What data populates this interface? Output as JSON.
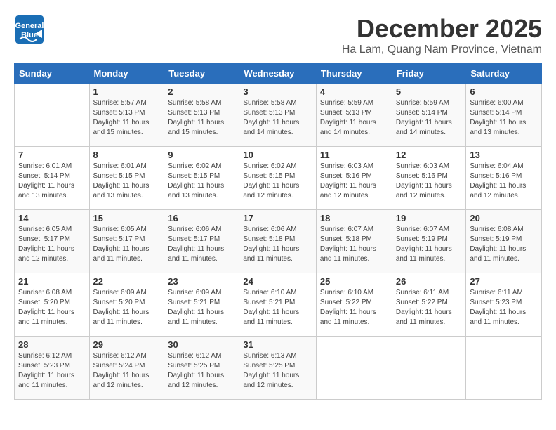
{
  "header": {
    "logo_general": "General",
    "logo_blue": "Blue",
    "month_title": "December 2025",
    "subtitle": "Ha Lam, Quang Nam Province, Vietnam"
  },
  "weekdays": [
    "Sunday",
    "Monday",
    "Tuesday",
    "Wednesday",
    "Thursday",
    "Friday",
    "Saturday"
  ],
  "weeks": [
    [
      {
        "day": "",
        "info": ""
      },
      {
        "day": "1",
        "info": "Sunrise: 5:57 AM\nSunset: 5:13 PM\nDaylight: 11 hours\nand 15 minutes."
      },
      {
        "day": "2",
        "info": "Sunrise: 5:58 AM\nSunset: 5:13 PM\nDaylight: 11 hours\nand 15 minutes."
      },
      {
        "day": "3",
        "info": "Sunrise: 5:58 AM\nSunset: 5:13 PM\nDaylight: 11 hours\nand 14 minutes."
      },
      {
        "day": "4",
        "info": "Sunrise: 5:59 AM\nSunset: 5:13 PM\nDaylight: 11 hours\nand 14 minutes."
      },
      {
        "day": "5",
        "info": "Sunrise: 5:59 AM\nSunset: 5:14 PM\nDaylight: 11 hours\nand 14 minutes."
      },
      {
        "day": "6",
        "info": "Sunrise: 6:00 AM\nSunset: 5:14 PM\nDaylight: 11 hours\nand 13 minutes."
      }
    ],
    [
      {
        "day": "7",
        "info": "Sunrise: 6:01 AM\nSunset: 5:14 PM\nDaylight: 11 hours\nand 13 minutes."
      },
      {
        "day": "8",
        "info": "Sunrise: 6:01 AM\nSunset: 5:15 PM\nDaylight: 11 hours\nand 13 minutes."
      },
      {
        "day": "9",
        "info": "Sunrise: 6:02 AM\nSunset: 5:15 PM\nDaylight: 11 hours\nand 13 minutes."
      },
      {
        "day": "10",
        "info": "Sunrise: 6:02 AM\nSunset: 5:15 PM\nDaylight: 11 hours\nand 12 minutes."
      },
      {
        "day": "11",
        "info": "Sunrise: 6:03 AM\nSunset: 5:16 PM\nDaylight: 11 hours\nand 12 minutes."
      },
      {
        "day": "12",
        "info": "Sunrise: 6:03 AM\nSunset: 5:16 PM\nDaylight: 11 hours\nand 12 minutes."
      },
      {
        "day": "13",
        "info": "Sunrise: 6:04 AM\nSunset: 5:16 PM\nDaylight: 11 hours\nand 12 minutes."
      }
    ],
    [
      {
        "day": "14",
        "info": "Sunrise: 6:05 AM\nSunset: 5:17 PM\nDaylight: 11 hours\nand 12 minutes."
      },
      {
        "day": "15",
        "info": "Sunrise: 6:05 AM\nSunset: 5:17 PM\nDaylight: 11 hours\nand 11 minutes."
      },
      {
        "day": "16",
        "info": "Sunrise: 6:06 AM\nSunset: 5:17 PM\nDaylight: 11 hours\nand 11 minutes."
      },
      {
        "day": "17",
        "info": "Sunrise: 6:06 AM\nSunset: 5:18 PM\nDaylight: 11 hours\nand 11 minutes."
      },
      {
        "day": "18",
        "info": "Sunrise: 6:07 AM\nSunset: 5:18 PM\nDaylight: 11 hours\nand 11 minutes."
      },
      {
        "day": "19",
        "info": "Sunrise: 6:07 AM\nSunset: 5:19 PM\nDaylight: 11 hours\nand 11 minutes."
      },
      {
        "day": "20",
        "info": "Sunrise: 6:08 AM\nSunset: 5:19 PM\nDaylight: 11 hours\nand 11 minutes."
      }
    ],
    [
      {
        "day": "21",
        "info": "Sunrise: 6:08 AM\nSunset: 5:20 PM\nDaylight: 11 hours\nand 11 minutes."
      },
      {
        "day": "22",
        "info": "Sunrise: 6:09 AM\nSunset: 5:20 PM\nDaylight: 11 hours\nand 11 minutes."
      },
      {
        "day": "23",
        "info": "Sunrise: 6:09 AM\nSunset: 5:21 PM\nDaylight: 11 hours\nand 11 minutes."
      },
      {
        "day": "24",
        "info": "Sunrise: 6:10 AM\nSunset: 5:21 PM\nDaylight: 11 hours\nand 11 minutes."
      },
      {
        "day": "25",
        "info": "Sunrise: 6:10 AM\nSunset: 5:22 PM\nDaylight: 11 hours\nand 11 minutes."
      },
      {
        "day": "26",
        "info": "Sunrise: 6:11 AM\nSunset: 5:22 PM\nDaylight: 11 hours\nand 11 minutes."
      },
      {
        "day": "27",
        "info": "Sunrise: 6:11 AM\nSunset: 5:23 PM\nDaylight: 11 hours\nand 11 minutes."
      }
    ],
    [
      {
        "day": "28",
        "info": "Sunrise: 6:12 AM\nSunset: 5:23 PM\nDaylight: 11 hours\nand 11 minutes."
      },
      {
        "day": "29",
        "info": "Sunrise: 6:12 AM\nSunset: 5:24 PM\nDaylight: 11 hours\nand 12 minutes."
      },
      {
        "day": "30",
        "info": "Sunrise: 6:12 AM\nSunset: 5:25 PM\nDaylight: 11 hours\nand 12 minutes."
      },
      {
        "day": "31",
        "info": "Sunrise: 6:13 AM\nSunset: 5:25 PM\nDaylight: 11 hours\nand 12 minutes."
      },
      {
        "day": "",
        "info": ""
      },
      {
        "day": "",
        "info": ""
      },
      {
        "day": "",
        "info": ""
      }
    ]
  ]
}
